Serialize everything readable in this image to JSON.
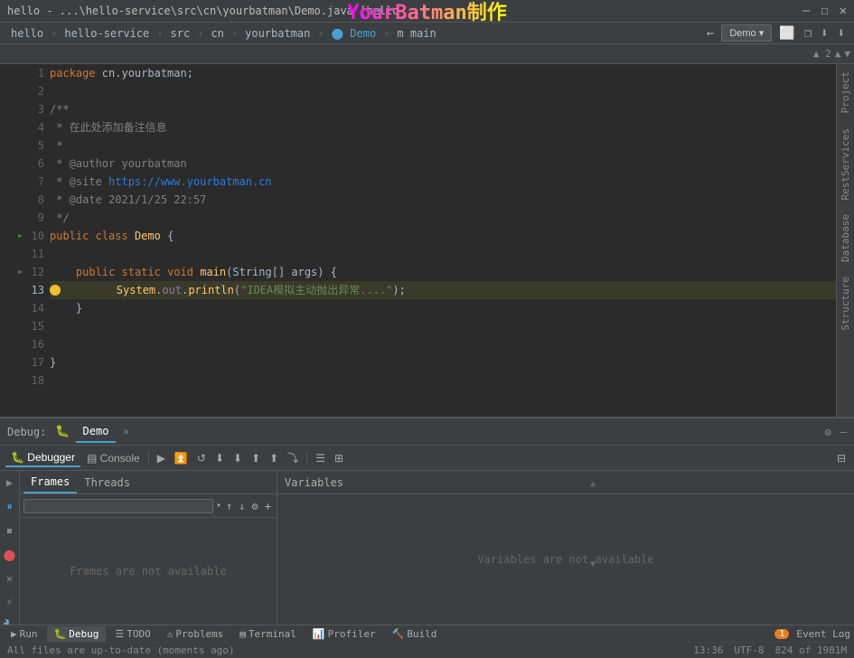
{
  "titlebar": {
    "title": "hello - ...\\hello-service\\src\\cn\\yourbatman\\Demo.java [hello",
    "watermark": "YourBatman制作",
    "controls": [
      "—",
      "☐",
      "✕"
    ]
  },
  "navbar": {
    "items": [
      "hello",
      "hello-service",
      "src",
      "cn",
      "yourbatman",
      "Demo",
      "main"
    ],
    "active_file": "Demo",
    "run_config": "Demo",
    "icons": [
      "←",
      "⚙",
      "⬜",
      "❐",
      "⬇"
    ]
  },
  "gutter": {
    "left_label": "▲ 2",
    "arrows": [
      "▲",
      "▼"
    ]
  },
  "code": {
    "lines": [
      {
        "num": 1,
        "content": "package cn.yourbatman;",
        "tokens": [
          {
            "type": "kw-package",
            "text": "package"
          },
          {
            "type": "normal",
            "text": " cn.yourbatman;"
          }
        ]
      },
      {
        "num": 2,
        "content": ""
      },
      {
        "num": 3,
        "content": "/**",
        "tokens": [
          {
            "type": "comment",
            "text": "/**"
          }
        ]
      },
      {
        "num": 4,
        "content": " * 在此处添加备注信息",
        "tokens": [
          {
            "type": "comment",
            "text": " * 在此处添加备注信息"
          }
        ]
      },
      {
        "num": 5,
        "content": " *",
        "tokens": [
          {
            "type": "comment",
            "text": " *"
          }
        ]
      },
      {
        "num": 6,
        "content": " * @author yourbatman",
        "tokens": [
          {
            "type": "comment",
            "text": " * @author yourbatman"
          }
        ]
      },
      {
        "num": 7,
        "content": " * @site https://www.yourbatman.cn",
        "tokens": [
          {
            "type": "comment",
            "text": " * @site "
          },
          {
            "type": "link-color",
            "text": "https://www.yourbatman.cn"
          }
        ]
      },
      {
        "num": 8,
        "content": " * @date 2021/1/25 22:57",
        "tokens": [
          {
            "type": "comment",
            "text": " * @date 2021/1/25 22:57"
          }
        ]
      },
      {
        "num": 9,
        "content": " */",
        "tokens": [
          {
            "type": "comment",
            "text": " */"
          }
        ]
      },
      {
        "num": 10,
        "content": "public class Demo {",
        "tokens": [
          {
            "type": "kw-public",
            "text": "public"
          },
          {
            "type": "normal",
            "text": " "
          },
          {
            "type": "kw-class",
            "text": "class"
          },
          {
            "type": "normal",
            "text": " "
          },
          {
            "type": "class-name",
            "text": "Demo"
          },
          {
            "type": "normal",
            "text": " {"
          }
        ],
        "has_arrow": true
      },
      {
        "num": 11,
        "content": ""
      },
      {
        "num": 12,
        "content": "    public static void main(String[] args) {",
        "tokens": [
          {
            "type": "kw-public",
            "text": "public"
          },
          {
            "type": "normal",
            "text": " "
          },
          {
            "type": "kw-static",
            "text": "static"
          },
          {
            "type": "normal",
            "text": " "
          },
          {
            "type": "kw-void",
            "text": "void"
          },
          {
            "type": "normal",
            "text": " "
          },
          {
            "type": "method-name",
            "text": "main"
          },
          {
            "type": "normal",
            "text": "(String[] args) {"
          }
        ],
        "has_arrow": true
      },
      {
        "num": 13,
        "content": "        System.out.println(\"IDEA模拟主动抛出异常....\");",
        "highlight": true,
        "has_debug_dot": true,
        "tokens": [
          {
            "type": "normal",
            "text": "        "
          },
          {
            "type": "class-name",
            "text": "System"
          },
          {
            "type": "normal",
            "text": "."
          },
          {
            "type": "out-obj",
            "text": "out"
          },
          {
            "type": "normal",
            "text": "."
          },
          {
            "type": "method-name",
            "text": "println"
          },
          {
            "type": "normal",
            "text": "("
          },
          {
            "type": "str-val",
            "text": "\"IDEA模拟主动抛出异常....\""
          }
        ],
        "tokens_end": [
          {
            "type": "normal",
            "text": ");"
          }
        ]
      },
      {
        "num": 14,
        "content": "    }",
        "tokens": [
          {
            "type": "normal",
            "text": "    }"
          }
        ]
      },
      {
        "num": 15,
        "content": ""
      },
      {
        "num": 16,
        "content": ""
      },
      {
        "num": 17,
        "content": "}",
        "tokens": [
          {
            "type": "normal",
            "text": "}"
          }
        ]
      },
      {
        "num": 18,
        "content": ""
      }
    ]
  },
  "right_sidebar": {
    "tabs": [
      "Project",
      "RestServices",
      "Database",
      "Structure"
    ]
  },
  "debug_panel": {
    "title": "Debug:",
    "tab_name": "Demo",
    "tabs": [
      {
        "label": "Debugger",
        "icon": "🐛",
        "active": true
      },
      {
        "label": "Console",
        "icon": "▤",
        "active": false
      }
    ],
    "toolbar_buttons": [
      "⚙",
      "—"
    ],
    "debugger_tools": [
      "▶",
      "⏹",
      "↻",
      "⬇",
      "⬇",
      "⬆",
      "⬆",
      "⤵",
      "☰",
      "⊞"
    ],
    "frames_threads": {
      "tabs": [
        "Frames",
        "Threads"
      ],
      "active": "Frames",
      "empty_message": "Frames are not available",
      "input_placeholder": ""
    },
    "variables": {
      "header": "Variables",
      "empty_message": "Variables are not available"
    },
    "left_icons": [
      "▶",
      "⏸",
      "⏹",
      "🔴",
      "✕",
      "⚡",
      "🔧",
      "≫"
    ]
  },
  "bottom_tabs": [
    {
      "label": "Run",
      "icon": "▶",
      "active": false
    },
    {
      "label": "Debug",
      "icon": "🐛",
      "active": true
    },
    {
      "label": "TODO",
      "icon": "☰",
      "active": false
    },
    {
      "label": "Problems",
      "icon": "⚠",
      "active": false
    },
    {
      "label": "Terminal",
      "icon": "▤",
      "active": false
    },
    {
      "label": "Profiler",
      "icon": "📊",
      "active": false
    },
    {
      "label": "Build",
      "icon": "🔨",
      "active": false
    }
  ],
  "status_bar": {
    "message": "All files are up-to-date (moments ago)",
    "time": "13:36",
    "encoding": "UTF-8",
    "memory": "824 of 1981M",
    "event_log": "Event Log",
    "event_count": "1"
  }
}
